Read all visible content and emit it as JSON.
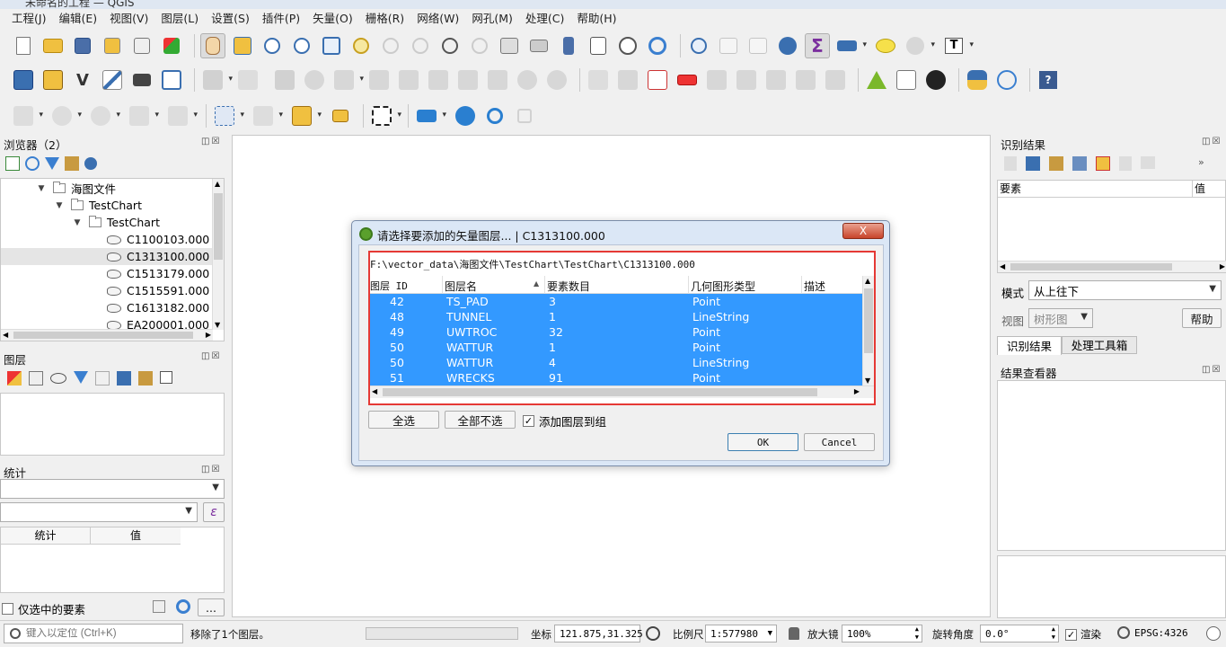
{
  "window": {
    "title": "未命名的工程 — QGIS"
  },
  "menu": [
    "工程(J)",
    "编辑(E)",
    "视图(V)",
    "图层(L)",
    "设置(S)",
    "插件(P)",
    "矢量(O)",
    "栅格(R)",
    "网络(W)",
    "网孔(M)",
    "处理(C)",
    "帮助(H)"
  ],
  "browser": {
    "title": "浏览器（2）",
    "tree": [
      {
        "label": "海图文件",
        "level": 0,
        "type": "folder",
        "expanded": true
      },
      {
        "label": "TestChart",
        "level": 1,
        "type": "folder",
        "expanded": true
      },
      {
        "label": "TestChart",
        "level": 2,
        "type": "folder",
        "expanded": true
      },
      {
        "label": "C1100103.000",
        "level": 3,
        "type": "layer"
      },
      {
        "label": "C1313100.000",
        "level": 3,
        "type": "layer",
        "selected": true
      },
      {
        "label": "C1513179.000",
        "level": 3,
        "type": "layer"
      },
      {
        "label": "C1515591.000",
        "level": 3,
        "type": "layer"
      },
      {
        "label": "C1613182.000",
        "level": 3,
        "type": "layer"
      },
      {
        "label": "EA200001.000",
        "level": 3,
        "type": "layer"
      }
    ]
  },
  "layers_panel": {
    "title": "图层"
  },
  "stats_panel": {
    "title": "统计",
    "col_stat": "统计",
    "col_value": "值",
    "selected_only": "仅选中的要素",
    "more": "..."
  },
  "identify": {
    "title": "识别结果",
    "col_feature": "要素",
    "col_value": "值",
    "mode_label": "模式",
    "mode_value": "从上往下",
    "view_label": "视图",
    "view_value": "树形图",
    "help": "帮助",
    "tab_identify": "识别结果",
    "tab_toolbox": "处理工具箱",
    "result_viewer": "结果查看器"
  },
  "dialog": {
    "title": "请选择要添加的矢量图层... | C1313100.000",
    "path": "F:\\vector_data\\海图文件\\TestChart\\TestChart\\C1313100.000",
    "columns": [
      "图层 ID",
      "图层名",
      "要素数目",
      "几何图形类型",
      "描述"
    ],
    "rows": [
      [
        "42",
        "TS_PAD",
        "3",
        "Point",
        ""
      ],
      [
        "48",
        "TUNNEL",
        "1",
        "LineString",
        ""
      ],
      [
        "49",
        "UWTROC",
        "32",
        "Point",
        ""
      ],
      [
        "50",
        "WATTUR",
        "1",
        "Point",
        ""
      ],
      [
        "50",
        "WATTUR",
        "4",
        "LineString",
        ""
      ],
      [
        "51",
        "WRECKS",
        "91",
        "Point",
        ""
      ]
    ],
    "select_all": "全选",
    "deselect_all": "全部不选",
    "add_to_group": "添加图层到组",
    "add_to_group_checked": true,
    "ok": "OK",
    "cancel": "Cancel",
    "close": "X"
  },
  "status": {
    "locate_placeholder": "键入以定位 (Ctrl+K)",
    "message": "移除了1个图层。",
    "coord_label": "坐标",
    "coord_value": "121.875,31.325",
    "scale_label": "比例尺",
    "scale_value": "1:577980",
    "magnifier_label": "放大镜",
    "magnifier_value": "100%",
    "rotation_label": "旋转角度",
    "rotation_value": "0.0°",
    "render_label": "渲染",
    "epsg": "EPSG:4326"
  }
}
